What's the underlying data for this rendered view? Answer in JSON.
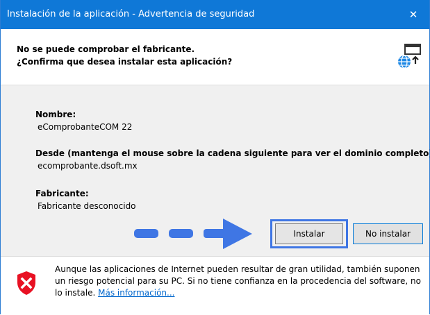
{
  "window": {
    "title": "Instalación de la aplicación - Advertencia de seguridad",
    "close_glyph": "✕"
  },
  "header": {
    "line1": "No se puede comprobar el fabricante.",
    "line2": "¿Confirma que desea instalar esta aplicación?",
    "icon": "globe-install-icon"
  },
  "details": {
    "name_label": "Nombre:",
    "name_value": "eComprobanteCOM 22",
    "from_label": "Desde (mantenga el mouse sobre la cadena siguiente para ver el dominio completo):",
    "from_value": "ecomprobante.dsoft.mx",
    "publisher_label": "Fabricante:",
    "publisher_value": "Fabricante desconocido"
  },
  "buttons": {
    "install": "Instalar",
    "dont_install": "No instalar"
  },
  "footer": {
    "warning_text": "Aunque las aplicaciones de Internet pueden resultar de gran utilidad, también suponen un riesgo potencial para su PC. Si no tiene confianza en la procedencia del software, no lo instale.",
    "more_info_link": "Más información...",
    "icon": "shield-warning-icon"
  },
  "colors": {
    "titlebar": "#0f78d7",
    "arrow": "#3f76e4",
    "link": "#0066cc",
    "shield": "#e81123"
  }
}
